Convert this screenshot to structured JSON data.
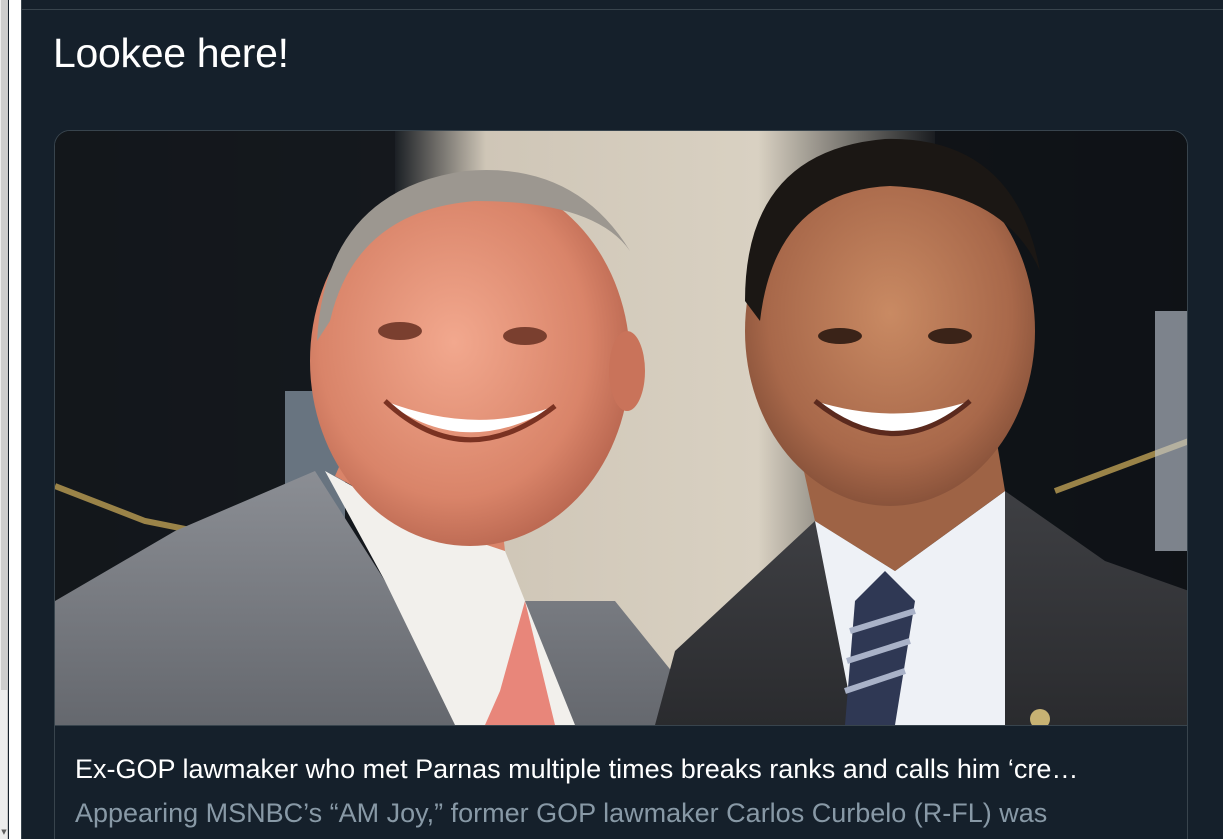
{
  "tweet": {
    "text": "Lookee here!"
  },
  "card": {
    "image_icon": "photo-two-men-suits",
    "title": "Ex-GOP lawmaker who met Parnas multiple times breaks ranks and calls him ‘cre…",
    "description": "Appearing MSNBC’s “AM Joy,” former GOP lawmaker Carlos Curbelo (R-FL) was"
  },
  "scrollbar": {
    "down_arrow": "▼"
  },
  "colors": {
    "background": "#15202b",
    "border": "#38444d",
    "text_primary": "#ffffff",
    "text_secondary": "#8899a6"
  }
}
